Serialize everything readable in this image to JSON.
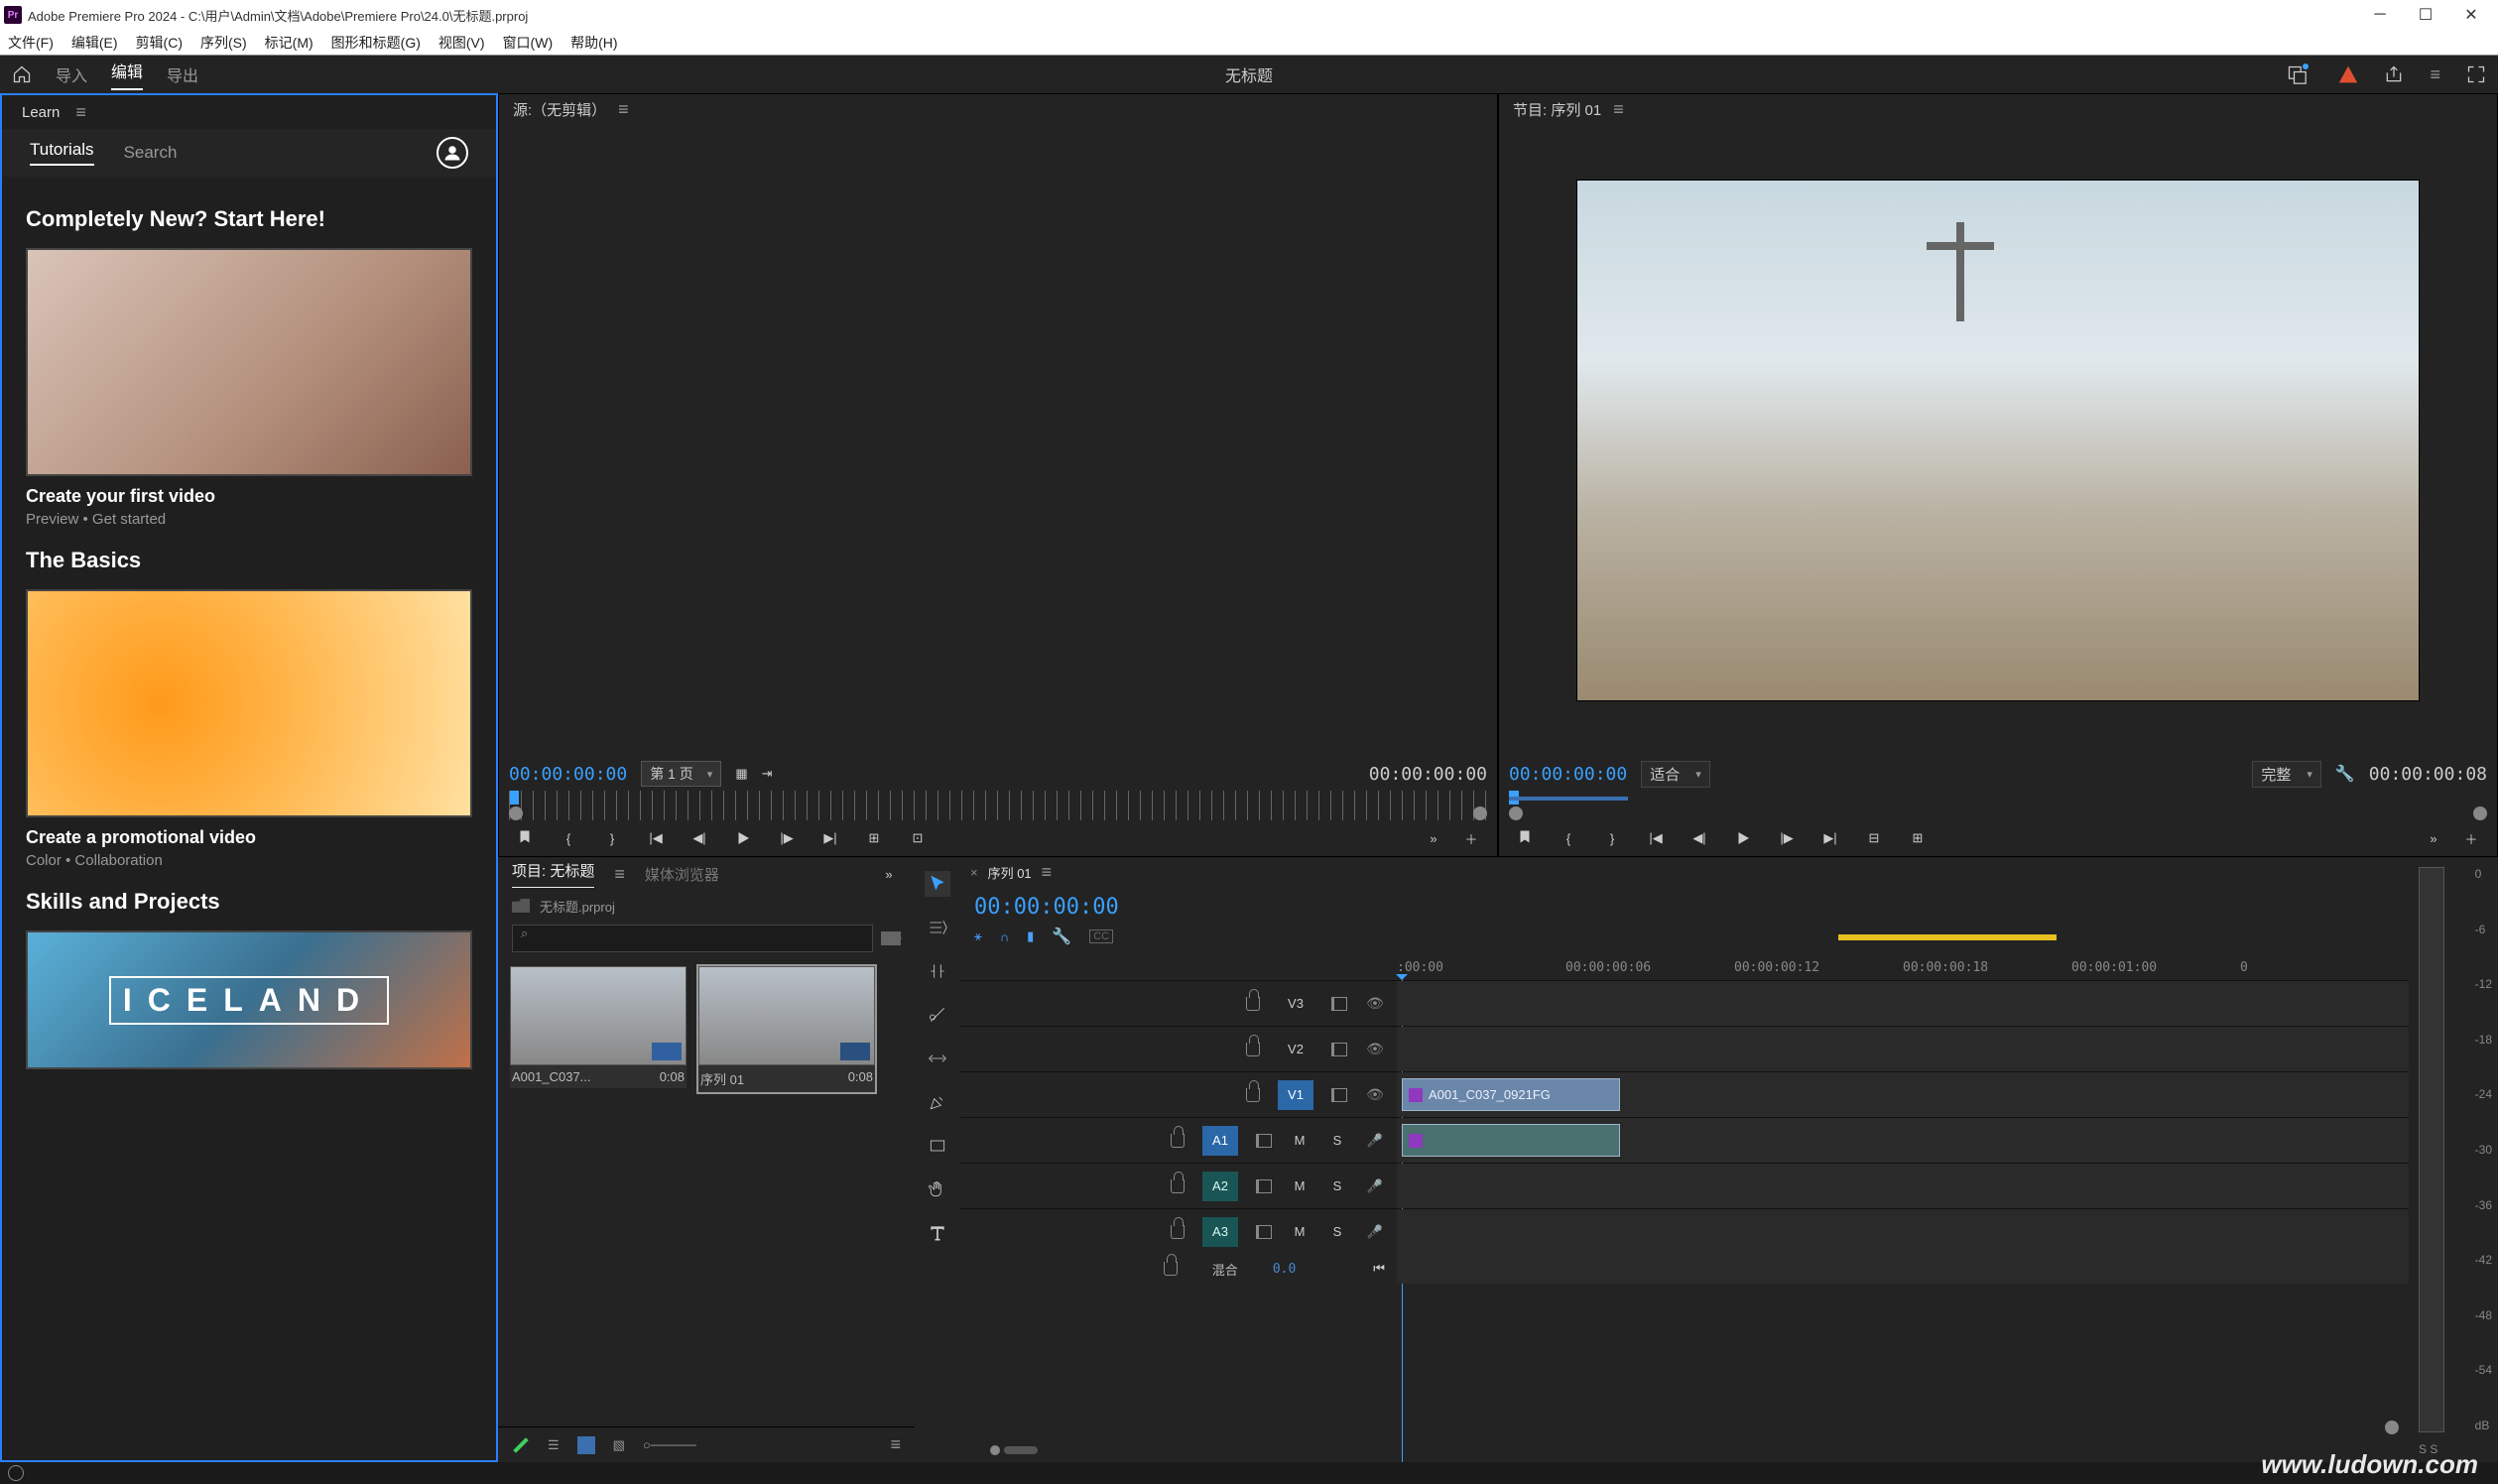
{
  "title": "Adobe Premiere Pro 2024 - C:\\用户\\Admin\\文档\\Adobe\\Premiere Pro\\24.0\\无标题.prproj",
  "menu": [
    "文件(F)",
    "编辑(E)",
    "剪辑(C)",
    "序列(S)",
    "标记(M)",
    "图形和标题(G)",
    "视图(V)",
    "窗口(W)",
    "帮助(H)"
  ],
  "appTabs": {
    "import": "导入",
    "edit": "编辑",
    "export": "导出"
  },
  "docName": "无标题",
  "learn": {
    "panelLabel": "Learn",
    "subtabs": {
      "tutorials": "Tutorials",
      "search": "Search"
    },
    "sections": [
      {
        "heading": "Completely New? Start Here!",
        "cardTitle": "Create your first video",
        "cardSub": "Preview  •  Get started"
      },
      {
        "heading": "The Basics",
        "cardTitle": "Create a promotional video",
        "cardSub": "Color  •  Collaboration"
      },
      {
        "heading": "Skills and Projects",
        "cardTitle": "",
        "cardSub": ""
      }
    ],
    "icelandText": "ICELAND"
  },
  "source": {
    "tab": "源:（无剪辑）",
    "tcLeft": "00:00:00:00",
    "page": "第 1 页",
    "tcRight": "00:00:00:00"
  },
  "program": {
    "tab": "节目: 序列 01",
    "tcLeft": "00:00:00:00",
    "fit": "适合",
    "quality": "完整",
    "tcRight": "00:00:00:08"
  },
  "project": {
    "tabs": {
      "project": "项目: 无标题",
      "browser": "媒体浏览器"
    },
    "fileName": "无标题.prproj",
    "items": [
      {
        "name": "A001_C037...",
        "dur": "0:08"
      },
      {
        "name": "序列 01",
        "dur": "0:08"
      }
    ]
  },
  "timeline": {
    "seqTab": "序列 01",
    "tc": "00:00:00:00",
    "ruler": [
      ":00:00",
      "00:00:00:06",
      "00:00:00:12",
      "00:00:00:18",
      "00:00:01:00",
      "0"
    ],
    "tracks": {
      "v3": "V3",
      "v2": "V2",
      "v1": "V1",
      "a1": "A1",
      "a2": "A2",
      "a3": "A3",
      "mute": "M",
      "solo": "S"
    },
    "clipName": "A001_C037_0921FG",
    "mixLabel": "混合",
    "mixVal": "0.0"
  },
  "meter": {
    "ticks": [
      "0",
      "-6",
      "-12",
      "-18",
      "-24",
      "-30",
      "-36",
      "-42",
      "-48",
      "-54",
      "dB"
    ],
    "ss": "S  S"
  },
  "watermark": "www.ludown.com"
}
